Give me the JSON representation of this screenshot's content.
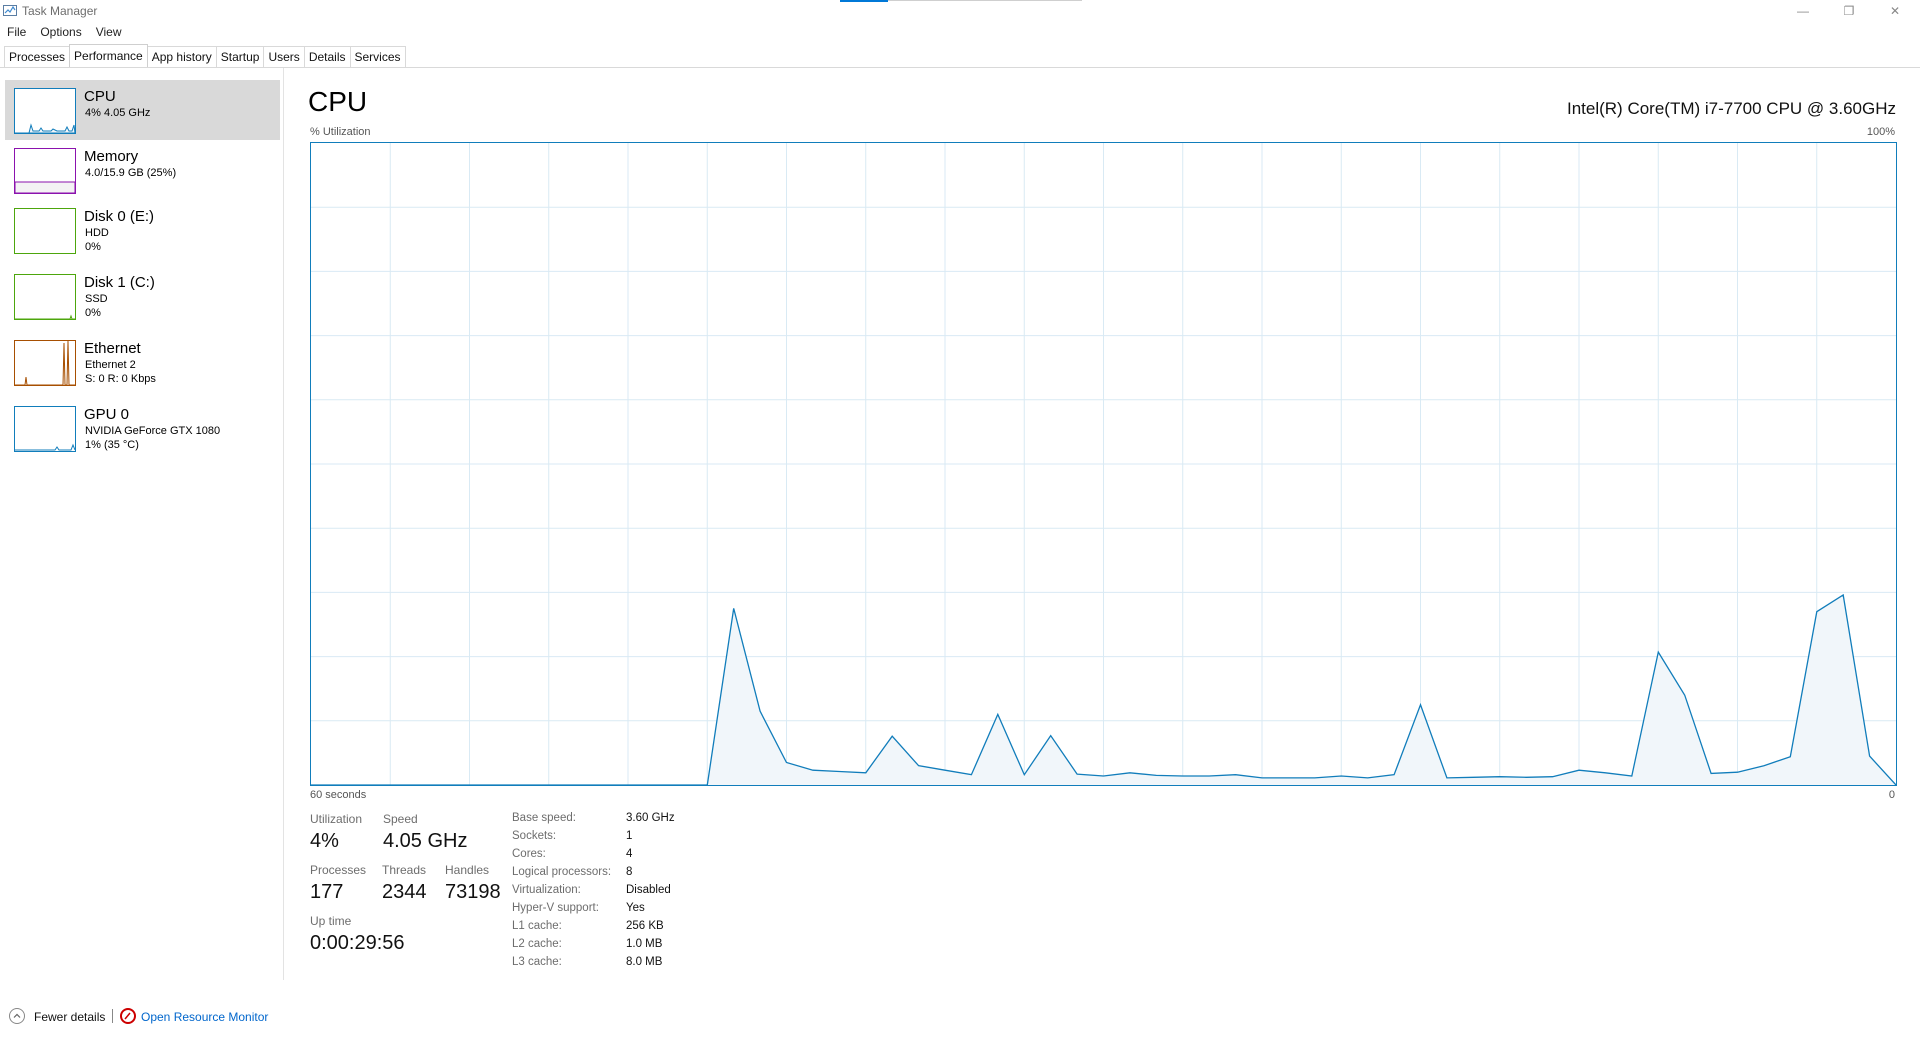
{
  "window": {
    "title": "Task Manager",
    "controls": {
      "minimize": "—",
      "restore": "❐",
      "close": "✕"
    }
  },
  "menu": [
    "File",
    "Options",
    "View"
  ],
  "tabs": [
    {
      "label": "Processes",
      "active": false
    },
    {
      "label": "Performance",
      "active": true
    },
    {
      "label": "App history",
      "active": false
    },
    {
      "label": "Startup",
      "active": false
    },
    {
      "label": "Users",
      "active": false
    },
    {
      "label": "Details",
      "active": false
    },
    {
      "label": "Services",
      "active": false
    }
  ],
  "sidebar": {
    "items": [
      {
        "name": "CPU",
        "sub1": "4% 4.05 GHz",
        "sub2": "",
        "color": "#117dbb",
        "selected": true
      },
      {
        "name": "Memory",
        "sub1": "4.0/15.9 GB (25%)",
        "sub2": "",
        "color": "#8b12ae",
        "selected": false
      },
      {
        "name": "Disk 0 (E:)",
        "sub1": "HDD",
        "sub2": "0%",
        "color": "#4da60c",
        "selected": false
      },
      {
        "name": "Disk 1 (C:)",
        "sub1": "SSD",
        "sub2": "0%",
        "color": "#4da60c",
        "selected": false
      },
      {
        "name": "Ethernet",
        "sub1": "Ethernet 2",
        "sub2": "S: 0 R: 0 Kbps",
        "color": "#a74f01",
        "selected": false
      },
      {
        "name": "GPU 0",
        "sub1": "NVIDIA GeForce GTX 1080",
        "sub2": "1% (35 °C)",
        "color": "#117dbb",
        "selected": false
      }
    ]
  },
  "main": {
    "title": "CPU",
    "model": "Intel(R) Core(TM) i7-7700 CPU @ 3.60GHz",
    "graph": {
      "y_label": "% Utilization",
      "y_max_label": "100%",
      "x_left_label": "60 seconds",
      "x_right_label": "0",
      "line_color": "#117dbb",
      "fill_color": "#f1f6fa",
      "grid_color": "#d9eaf4"
    },
    "stats": {
      "utilization_label": "Utilization",
      "utilization": "4%",
      "speed_label": "Speed",
      "speed": "4.05 GHz",
      "processes_label": "Processes",
      "processes": "177",
      "threads_label": "Threads",
      "threads": "2344",
      "handles_label": "Handles",
      "handles": "73198",
      "uptime_label": "Up time",
      "uptime": "0:00:29:56"
    },
    "info": [
      {
        "label": "Base speed:",
        "value": "3.60 GHz"
      },
      {
        "label": "Sockets:",
        "value": "1"
      },
      {
        "label": "Cores:",
        "value": "4"
      },
      {
        "label": "Logical processors:",
        "value": "8"
      },
      {
        "label": "Virtualization:",
        "value": "Disabled"
      },
      {
        "label": "Hyper-V support:",
        "value": "Yes"
      },
      {
        "label": "L1 cache:",
        "value": "256 KB"
      },
      {
        "label": "L2 cache:",
        "value": "1.0 MB"
      },
      {
        "label": "L3 cache:",
        "value": "8.0 MB"
      }
    ]
  },
  "footer": {
    "fewer_details": "Fewer details",
    "resource_monitor": "Open Resource Monitor"
  },
  "chart_data": {
    "type": "area",
    "x": [
      60,
      59,
      58,
      57,
      56,
      55,
      54,
      53,
      52,
      51,
      50,
      49,
      48,
      47,
      46,
      45,
      44,
      43,
      42,
      41,
      40,
      39,
      38,
      37,
      36,
      35,
      34,
      33,
      32,
      31,
      30,
      29,
      28,
      27,
      26,
      25,
      24,
      23,
      22,
      21,
      20,
      19,
      18,
      17,
      16,
      15,
      14,
      13,
      12,
      11,
      10,
      9,
      8,
      7,
      6,
      5,
      4,
      3,
      2,
      1,
      0
    ],
    "values": [
      0,
      0,
      0,
      0,
      0,
      0,
      0,
      0,
      0,
      0,
      0,
      0,
      0,
      0,
      0,
      0,
      27.5,
      11.5,
      3.5,
      2.3,
      2.1,
      1.9,
      7.6,
      3,
      2.3,
      1.6,
      11,
      1.6,
      7.7,
      1.7,
      1.4,
      1.9,
      1.5,
      1.4,
      1.4,
      1.6,
      1.1,
      1.1,
      1.1,
      1.4,
      1.1,
      1.6,
      12.5,
      1.1,
      1.2,
      1.3,
      1.2,
      1.3,
      2.3,
      1.9,
      1.4,
      20.7,
      14,
      1.8,
      2,
      3,
      4.4,
      27,
      29.6,
      4.5,
      0
    ],
    "xlabel": "60 seconds",
    "ylabel": "% Utilization",
    "ylim": [
      0,
      100
    ],
    "grid": true
  }
}
